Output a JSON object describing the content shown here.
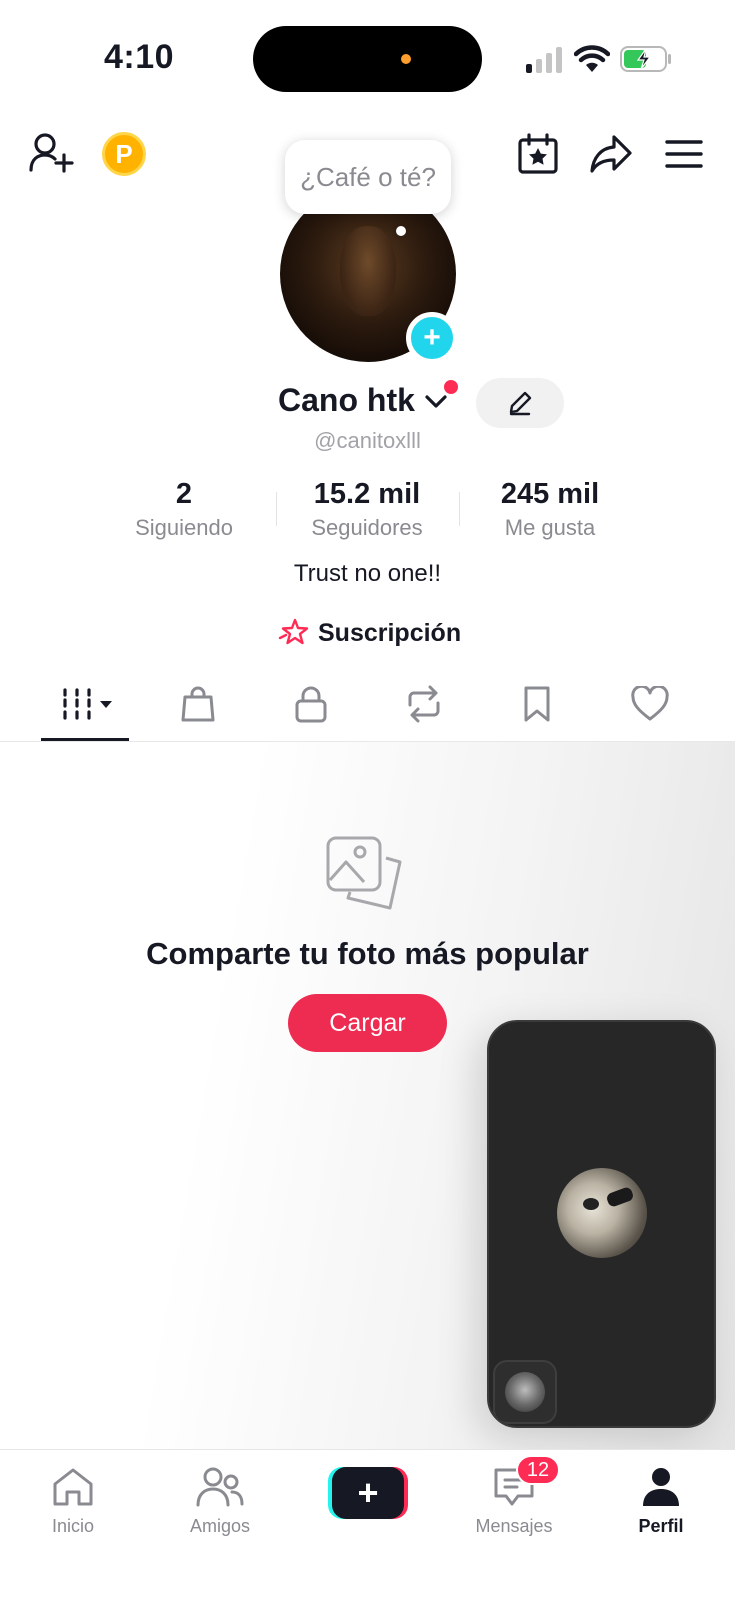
{
  "status_bar": {
    "time": "4:10"
  },
  "header": {
    "coin_letter": "P"
  },
  "profile": {
    "bubble_text": "¿Café o té?",
    "display_name": "Cano  htk",
    "username": "@canitoxlll",
    "bio": "Trust no one!!",
    "subscription_label": "Suscripción"
  },
  "stats": [
    {
      "value": "2",
      "label": "Siguiendo"
    },
    {
      "value": "15.2 mil",
      "label": "Seguidores"
    },
    {
      "value": "245 mil",
      "label": "Me gusta"
    }
  ],
  "tabs": [
    {
      "icon": "grid-icon",
      "selected": true
    },
    {
      "icon": "shopping-bag-icon"
    },
    {
      "icon": "lock-icon"
    },
    {
      "icon": "repost-icon"
    },
    {
      "icon": "bookmark-icon"
    },
    {
      "icon": "heart-icon"
    }
  ],
  "empty_state": {
    "title": "Comparte tu foto más popular",
    "button_label": "Cargar"
  },
  "bottom_nav": {
    "home": "Inicio",
    "friends": "Amigos",
    "create": "+",
    "inbox": "Mensajes",
    "inbox_badge": "12",
    "profile": "Perfil"
  },
  "colors": {
    "accent": "#fe2c55",
    "upload_button": "#ee2b51",
    "add_avatar": "#20d5ec",
    "text": "#161823",
    "secondary_text": "#8a8b91"
  }
}
